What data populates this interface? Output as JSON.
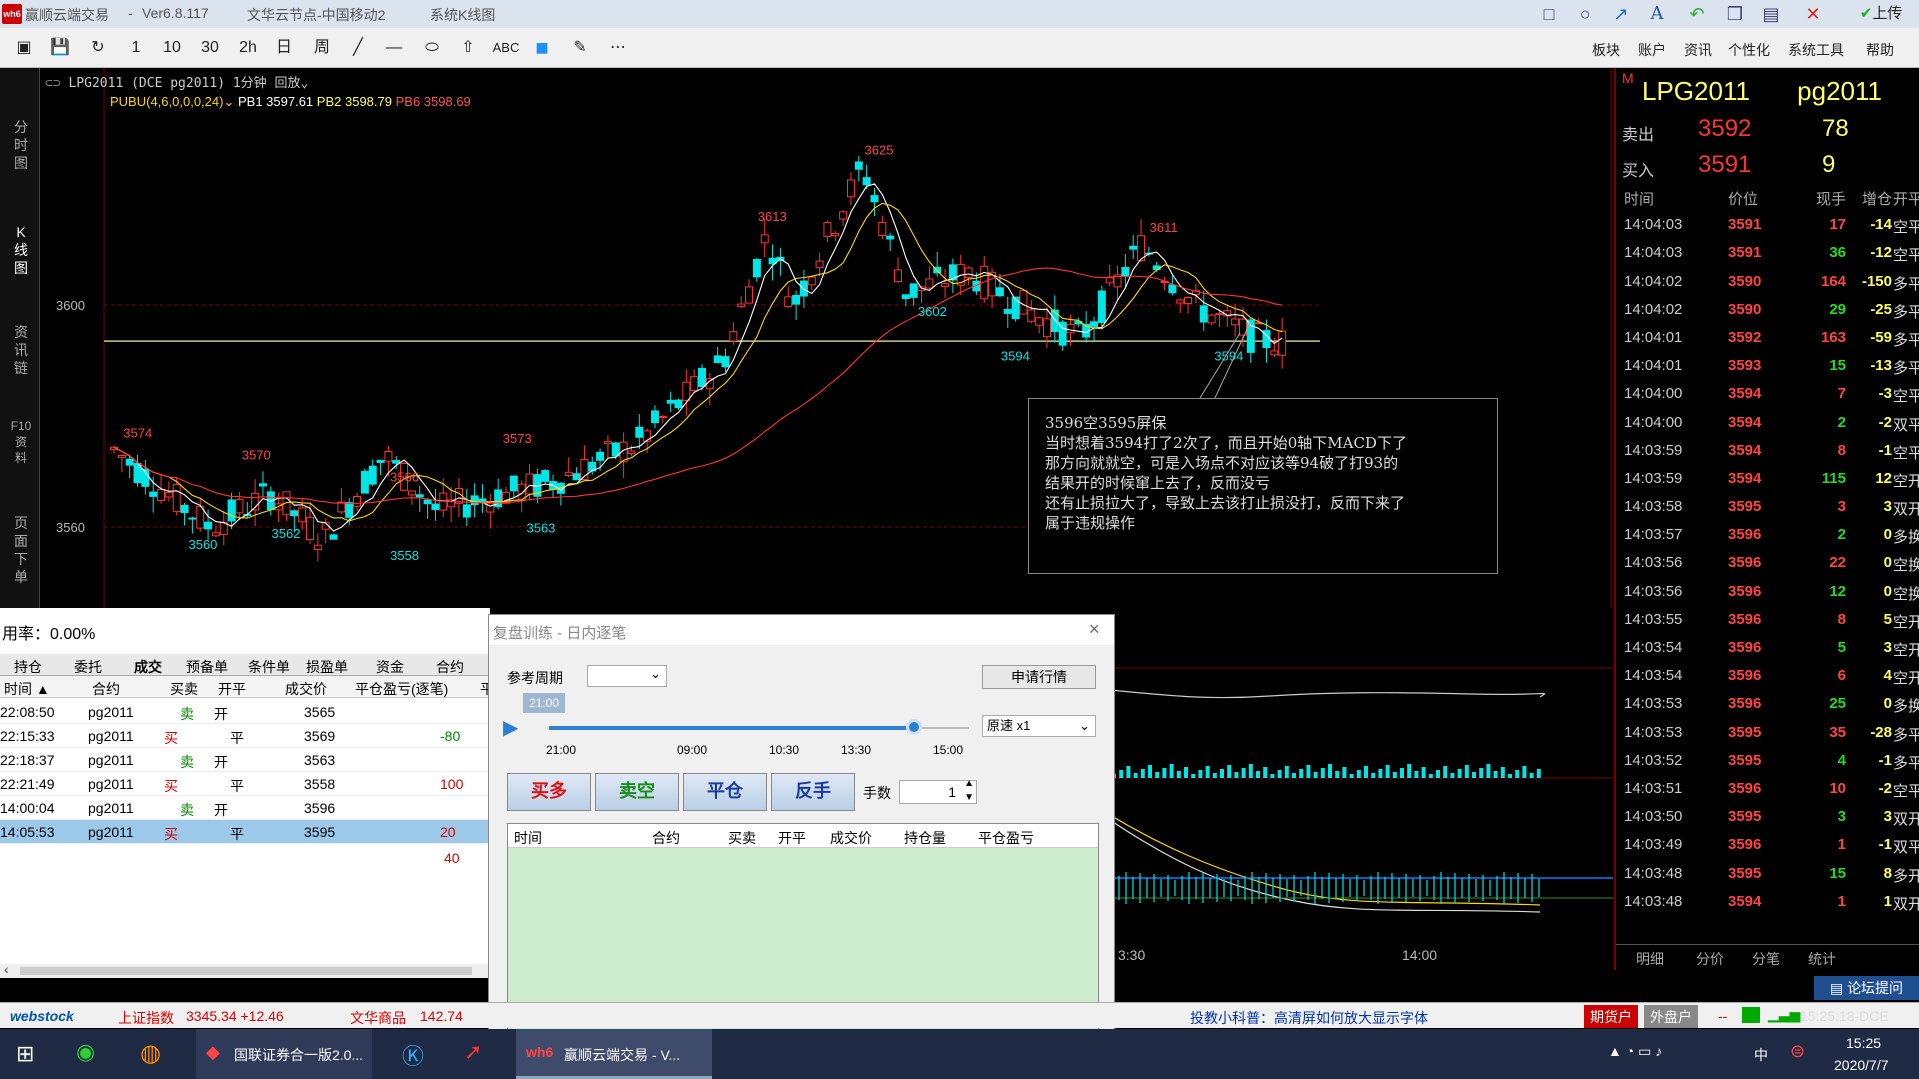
{
  "window": {
    "title": "赢顺云端交易",
    "version": "Ver6.8.117",
    "separator": "-",
    "node": "文华云节点-中国移动2",
    "view": "系统K线图",
    "upload_label": "上传",
    "logo_text": "wh6"
  },
  "toolbar": {
    "tools": [
      "▣",
      "💾",
      "↻",
      "1",
      "10",
      "30",
      "2h",
      "日",
      "周",
      "╱",
      "—",
      "⬭",
      "⇧",
      "ABC",
      "■",
      "✎",
      "⋯"
    ],
    "menu": [
      "板块",
      "账户",
      "资讯",
      "个性化",
      "系统工具",
      "帮助"
    ]
  },
  "leftnav": [
    "分时图",
    "K线图",
    "资讯链",
    "F10资料",
    "页面下单"
  ],
  "chart": {
    "symbol_line": "LPG2011 (DCE pg2011) 1分钟 回放",
    "indicator": {
      "name": "PUBU(4,6,0,0,0,24)",
      "pb1": "PB1 3597.61",
      "pb2": "PB2 3598.79",
      "pb6": "PB6 3598.69"
    },
    "y_labels": [
      {
        "v": 3600,
        "label": "3600"
      },
      {
        "v": 3560,
        "label": "3560"
      }
    ],
    "x_labels": [
      "3:30",
      "14:00"
    ],
    "annotations": [
      {
        "label": "3574",
        "color": "#ff4444"
      },
      {
        "label": "3570",
        "color": "#ff4444"
      },
      {
        "label": "3566",
        "color": "#ff4444"
      },
      {
        "label": "3573",
        "color": "#ff4444"
      },
      {
        "label": "3613",
        "color": "#ff4444"
      },
      {
        "label": "3625",
        "color": "#ff4444"
      },
      {
        "label": "3611",
        "color": "#ff4444"
      },
      {
        "label": "3560",
        "color": "#00e5e5"
      },
      {
        "label": "3562",
        "color": "#00e5e5"
      },
      {
        "label": "3558",
        "color": "#00e5e5"
      },
      {
        "label": "3563",
        "color": "#00e5e5"
      },
      {
        "label": "3602",
        "color": "#00e5e5"
      },
      {
        "label": "3594",
        "color": "#00e5e5"
      },
      {
        "label": "3594",
        "color": "#00e5e5"
      }
    ],
    "note": [
      "3596空3595屏保",
      "当时想着3594打了2次了，而且开始0轴下MACD下了",
      "那方向就就空，可是入场点不对应该等94破了打93的",
      "结果开的时候窜上去了，反而没亏",
      "还有止损拉大了，导致上去该打止损没打，反而下来了",
      "属于违规操作"
    ]
  },
  "quote": {
    "marker": "M",
    "name": "LPG2011",
    "code": "pg2011",
    "sell_label": "卖出",
    "sell_price": "3592",
    "sell_vol": "78",
    "buy_label": "买入",
    "buy_price": "3591",
    "buy_vol": "9",
    "header": [
      "时间",
      "价位",
      "现手",
      "增仓",
      "开平"
    ],
    "ticks": [
      [
        "14:04:03",
        "3591",
        "17",
        "-14",
        "空平"
      ],
      [
        "14:04:03",
        "3591",
        "36",
        "-12",
        "空平"
      ],
      [
        "14:04:02",
        "3590",
        "164",
        "-150",
        "多平"
      ],
      [
        "14:04:02",
        "3590",
        "29",
        "-25",
        "多平"
      ],
      [
        "14:04:01",
        "3592",
        "163",
        "-59",
        "多平"
      ],
      [
        "14:04:01",
        "3593",
        "15",
        "-13",
        "多平"
      ],
      [
        "14:04:00",
        "3594",
        "7",
        "-3",
        "空平"
      ],
      [
        "14:04:00",
        "3594",
        "2",
        "-2",
        "双平"
      ],
      [
        "14:03:59",
        "3594",
        "8",
        "-1",
        "空平"
      ],
      [
        "14:03:59",
        "3594",
        "115",
        "12",
        "空开"
      ],
      [
        "14:03:58",
        "3595",
        "3",
        "3",
        "双开"
      ],
      [
        "14:03:57",
        "3596",
        "2",
        "0",
        "多换"
      ],
      [
        "14:03:56",
        "3596",
        "22",
        "0",
        "空换"
      ],
      [
        "14:03:56",
        "3596",
        "12",
        "0",
        "空换"
      ],
      [
        "14:03:55",
        "3596",
        "8",
        "5",
        "空开"
      ],
      [
        "14:03:54",
        "3596",
        "5",
        "3",
        "空开"
      ],
      [
        "14:03:54",
        "3596",
        "6",
        "4",
        "空开"
      ],
      [
        "14:03:53",
        "3596",
        "25",
        "0",
        "多换"
      ],
      [
        "14:03:53",
        "3595",
        "35",
        "-28",
        "多平"
      ],
      [
        "14:03:52",
        "3595",
        "4",
        "-1",
        "多平"
      ],
      [
        "14:03:51",
        "3596",
        "10",
        "-2",
        "空平"
      ],
      [
        "14:03:50",
        "3595",
        "3",
        "3",
        "双开"
      ],
      [
        "14:03:49",
        "3596",
        "1",
        "-1",
        "双平"
      ],
      [
        "14:03:48",
        "3595",
        "15",
        "8",
        "多开"
      ],
      [
        "14:03:48",
        "3594",
        "1",
        "1",
        "双开"
      ]
    ],
    "tabs": [
      "明细",
      "分价",
      "分笔",
      "统计"
    ]
  },
  "trade": {
    "rate": "用率：0.00%",
    "tabs": [
      "持仓",
      "委托",
      "成交",
      "预备单",
      "条件单",
      "损盈单",
      "资金",
      "合约"
    ],
    "header": [
      "时间 ▲",
      "合约",
      "买卖",
      "开平",
      "成交价",
      "平仓盈亏(逐笔)",
      "平"
    ],
    "rows": [
      [
        "22:08:50",
        "pg2011",
        "卖",
        "开",
        "3565",
        ""
      ],
      [
        "22:15:33",
        "pg2011",
        "买",
        "平",
        "3569",
        "-80"
      ],
      [
        "22:18:37",
        "pg2011",
        "卖",
        "开",
        "3563",
        ""
      ],
      [
        "22:21:49",
        "pg2011",
        "买",
        "平",
        "3558",
        "100"
      ],
      [
        "14:00:04",
        "pg2011",
        "卖",
        "开",
        "3596",
        ""
      ],
      [
        "14:05:53",
        "pg2011",
        "买",
        "平",
        "3595",
        "20"
      ]
    ],
    "total": "40"
  },
  "dialog": {
    "title": "复盘训练 - 日内逐笔",
    "close": "×",
    "period_label": "参考周期",
    "apply_button": "申请行情",
    "slider_time": "21:00",
    "slider_progress": 0.87,
    "slider_labels": [
      "21:00",
      "09:00",
      "10:30",
      "13:30",
      "15:00"
    ],
    "speed": "原速 x1",
    "actions": [
      "买多",
      "卖空",
      "平仓",
      "反手"
    ],
    "qty_label": "手数",
    "qty_value": "1",
    "grid_header": [
      "时间",
      "合约",
      "买卖",
      "开平",
      "成交价",
      "持仓量",
      "平仓盈亏"
    ]
  },
  "status": {
    "brand": "webstock",
    "index_name": "上证指数",
    "index_value": "3345.34 +12.46",
    "commodity": "文华商品",
    "commodity_value": "142.74",
    "tip": "投教小科普：高清屏如何放大显示字体",
    "futures": "期货户",
    "external": "外盘户",
    "dash": "--",
    "time": "15:25:18-DCE",
    "forum": "论坛提问"
  },
  "taskbar": {
    "app1": "国联证券合一版2.0...",
    "app2": "赢顺云端交易 - V...",
    "ime": "中",
    "clock_time": "15:25",
    "clock_date": "2020/7/7"
  }
}
